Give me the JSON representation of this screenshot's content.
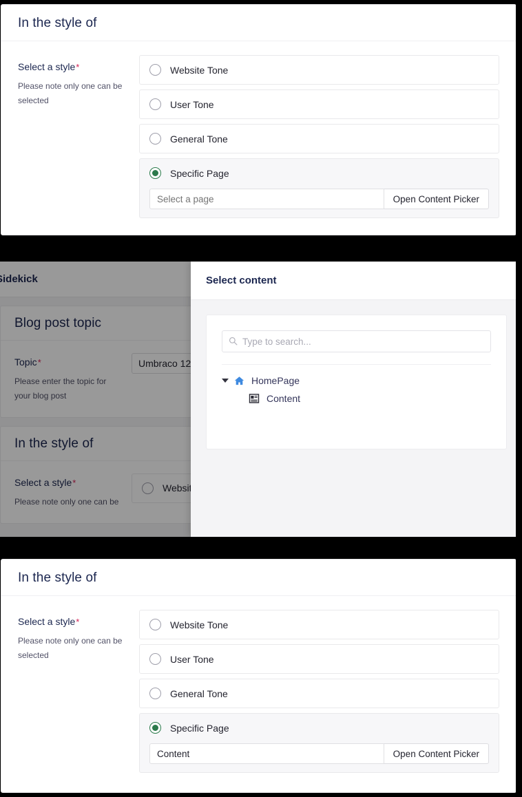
{
  "panel_top": {
    "title": "In the style of",
    "property": {
      "label": "Select a style",
      "required_marker": "*",
      "description": "Please note only one can be selected"
    },
    "options": [
      {
        "label": "Website Tone",
        "selected": false
      },
      {
        "label": "User Tone",
        "selected": false
      },
      {
        "label": "General Tone",
        "selected": false
      },
      {
        "label": "Specific Page",
        "selected": true
      }
    ],
    "page_picker": {
      "value": "",
      "placeholder": "Select a page",
      "button_label": "Open Content Picker"
    }
  },
  "panel_middle": {
    "app_title": "Sidekick",
    "blog_panel": {
      "title": "Blog post topic",
      "property": {
        "label": "Topic",
        "required_marker": "*",
        "description": "Please enter the topic for your blog post"
      },
      "topic_value": "Umbraco 12"
    },
    "style_panel": {
      "title": "In the style of",
      "property": {
        "label": "Select a style",
        "required_marker": "*",
        "description": "Please note only one can be"
      },
      "first_option_label": "Websit"
    },
    "modal": {
      "title": "Select content",
      "search_placeholder": "Type to search...",
      "search_value": "",
      "tree": [
        {
          "label": "HomePage",
          "icon": "home-icon",
          "expanded": true,
          "depth": 0
        },
        {
          "label": "Content",
          "icon": "document-icon",
          "expanded": false,
          "depth": 1
        }
      ]
    }
  },
  "panel_bottom": {
    "title": "In the style of",
    "property": {
      "label": "Select a style",
      "required_marker": "*",
      "description": "Please note only one can be selected"
    },
    "options": [
      {
        "label": "Website Tone",
        "selected": false
      },
      {
        "label": "User Tone",
        "selected": false
      },
      {
        "label": "General Tone",
        "selected": false
      },
      {
        "label": "Specific Page",
        "selected": true
      }
    ],
    "page_picker": {
      "value": "Content",
      "placeholder": "Select a page",
      "button_label": "Open Content Picker"
    }
  },
  "colors": {
    "accent_green": "#2b7a4b",
    "required_red": "#d42054",
    "home_icon_blue": "#3f8ae0",
    "heading_navy": "#1b264f",
    "band_black": "#000000"
  }
}
